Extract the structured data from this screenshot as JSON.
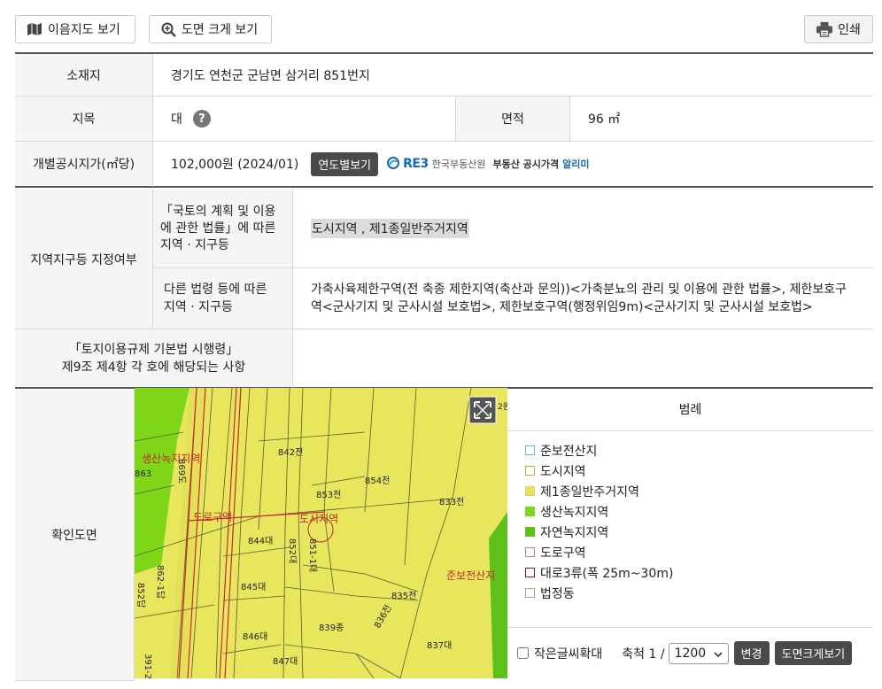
{
  "toolbar": {
    "map_button": "이음지도 보기",
    "zoom_button": "도면 크게 보기",
    "print_button": "인쇄"
  },
  "info": {
    "location_label": "소재지",
    "location_value": "경기도 연천군 군남면 삼거리 851번지",
    "category_label": "지목",
    "category_value": "대",
    "help_mark": "?",
    "area_label": "면적",
    "area_value": "96 ㎡",
    "price_label": "개별공시지가(㎡당)",
    "price_value": "102,000원 (2024/01)",
    "price_year_button": "연도별보기",
    "reb_logo": "RE3",
    "reb_name": "한국부동산원",
    "reb_service_a": "부동산 공시가격",
    "reb_service_b": "알리미",
    "zone_label": "지역지구등 지정여부",
    "zone_sub1_label": "「국토의 계획 및 이용\n에 관한 법률」에 따른\n지역 · 지구등",
    "zone_sub1_value": "도시지역 , 제1종일반주거지역",
    "zone_sub2_label": "다른 법령 등에 따른\n지역 · 지구등",
    "zone_sub2_value": "가축사육제한구역(전 축종 제한지역(축산과 문의))<가축분뇨의 관리 및 이용에 관한 법률>, 제한보호구역<군사기지 및 군사시설 보호법>, 제한보호구역(행정위임9m)<군사기지 및 군사시설 보호법>",
    "decree_label": "「토지이용규제 기본법 시행령」\n제9조 제4항 각 호에 해당되는 사항",
    "decree_value": "",
    "map_label": "확인도면"
  },
  "legend": {
    "title": "범례",
    "items": [
      {
        "label": "준보전산지",
        "border": "#6bb7b7",
        "fill": "#ffffff"
      },
      {
        "label": "도시지역",
        "border": "#b8b23a",
        "fill": "#ffffff"
      },
      {
        "label": "제1종일반주거지역",
        "border": "#d9d35a",
        "fill": "#e8e35c"
      },
      {
        "label": "생산녹지지역",
        "border": "#7cd61c",
        "fill": "#7cd61c"
      },
      {
        "label": "자연녹지지역",
        "border": "#5cc21a",
        "fill": "#5cc21a"
      },
      {
        "label": "도로구역",
        "border": "#c87a86",
        "fill": "#ffffff"
      },
      {
        "label": "대로3류(폭 25m~30m)",
        "border": "#7a1d26",
        "fill": "#ffffff"
      },
      {
        "label": "법정동",
        "border": "#b5a58a",
        "fill": "#ffffff"
      }
    ]
  },
  "mapbar": {
    "small_text_label": "작은글씨확대",
    "scale_label": "축척 1 /",
    "scale_value": "1200",
    "change_button": "변경",
    "enlarge_button": "도면크게보기"
  },
  "map_labels": {
    "parcels": [
      "842전",
      "854전",
      "853전",
      "833전",
      "844대",
      "845대",
      "835전",
      "839종",
      "846대",
      "837대",
      "847대",
      "836전",
      "852답",
      "862-1답",
      "863",
      "869도",
      "861-1도",
      "862-1도",
      "391-2도",
      "851대",
      "852대",
      "851-1대"
    ],
    "zones": [
      "생산녹지지역",
      "도로구역",
      "도시지역",
      "준보전산지"
    ],
    "corner": "2원"
  }
}
